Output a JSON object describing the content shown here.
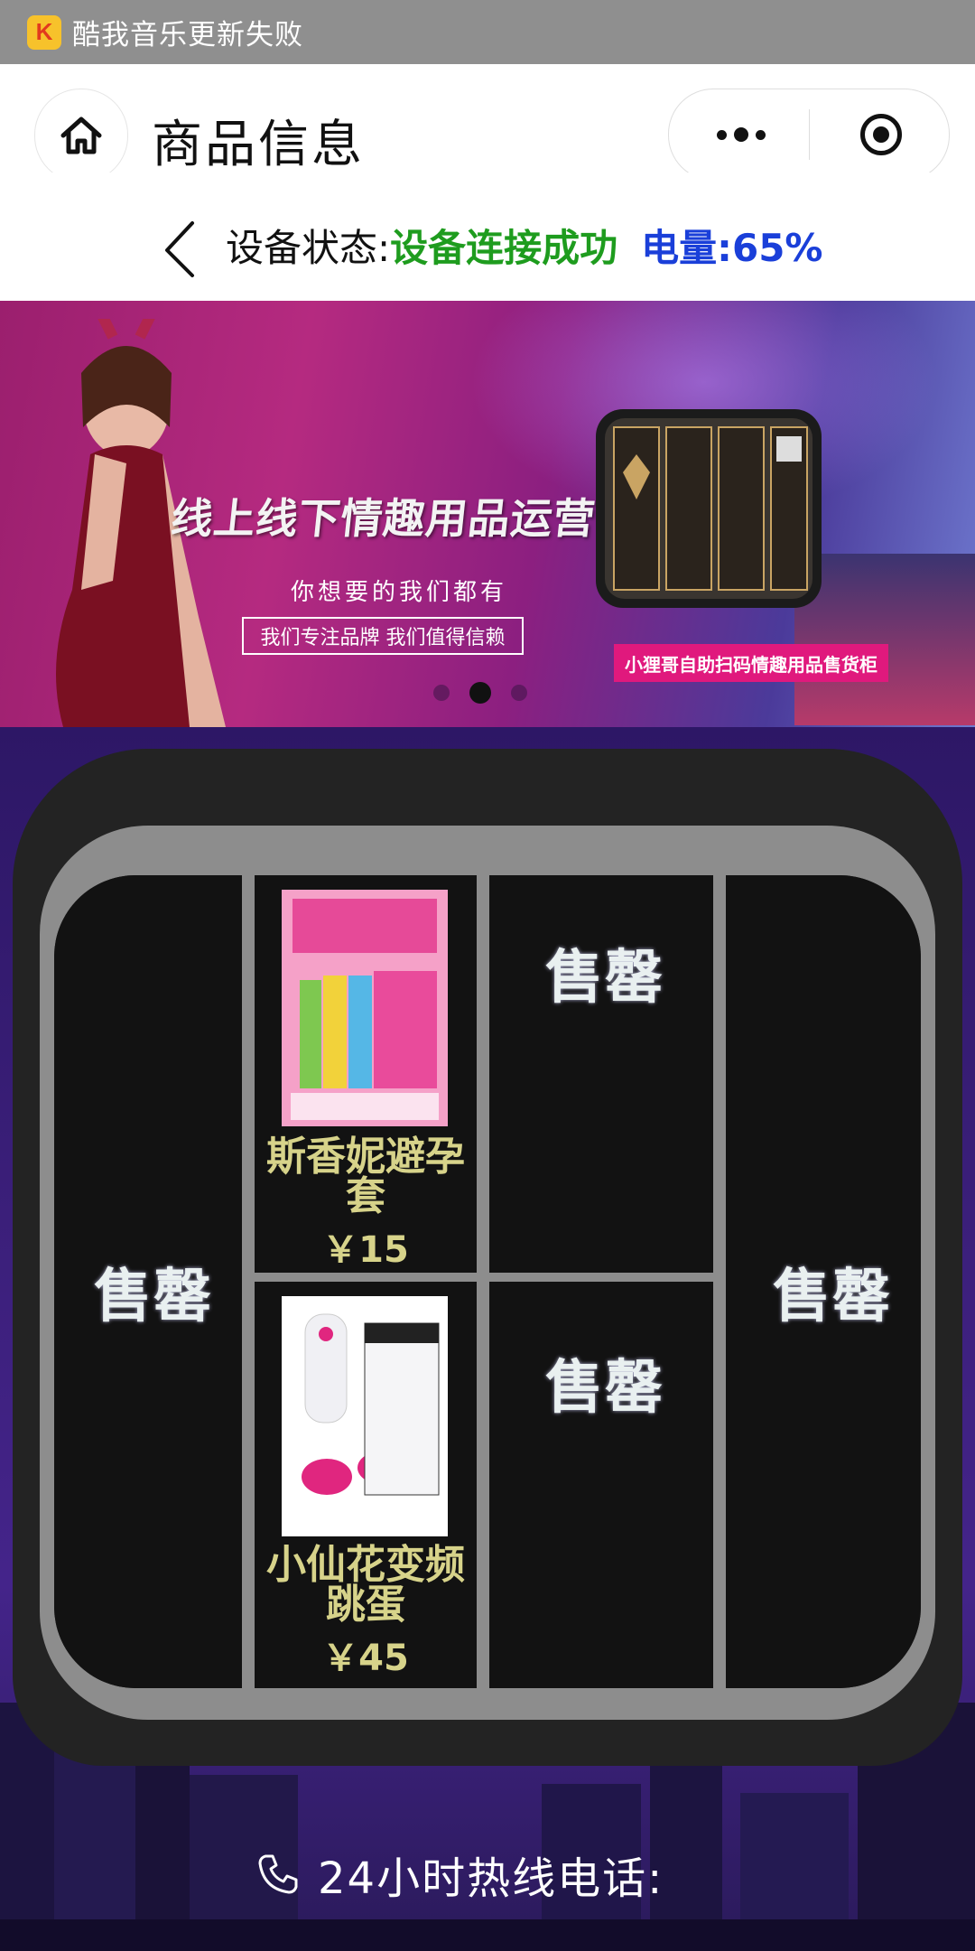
{
  "notification": {
    "app_icon": "music-app-icon",
    "text": "酷我音乐更新失败"
  },
  "titlebar": {
    "title": "商品信息",
    "home_icon": "home-icon",
    "more_icon": "more-dots-icon",
    "close_icon": "target-close-icon"
  },
  "status": {
    "label": "设备状态:",
    "value": "设备连接成功",
    "power": "电量:65%"
  },
  "banner": {
    "headline": "线上线下情趣用品运营商",
    "subline": "你想要的我们都有",
    "boxed_text": "我们专注品牌  我们值得信赖",
    "tag": "小狸哥自助扫码情趣用品售货柜",
    "page_indicator": {
      "total": 3,
      "active": 2
    }
  },
  "slots": {
    "left": {
      "label": "售罄"
    },
    "top_middle": {
      "name": "斯香妮避孕套",
      "price": "￥15"
    },
    "top_right": {
      "label": "售罄"
    },
    "far_right": {
      "label": "售罄"
    },
    "bottom_middle": {
      "name": "小仙花变频跳蛋",
      "price": "￥45"
    },
    "bottom_right": {
      "label": "售罄"
    }
  },
  "footer": {
    "hotline": "24小时热线电话:",
    "phone_icon": "phone-icon"
  },
  "colors": {
    "status_ok": "#1e9c1e",
    "power": "#1a3fd9",
    "price": "#d7d38a",
    "banner_tag": "#e0197d"
  }
}
